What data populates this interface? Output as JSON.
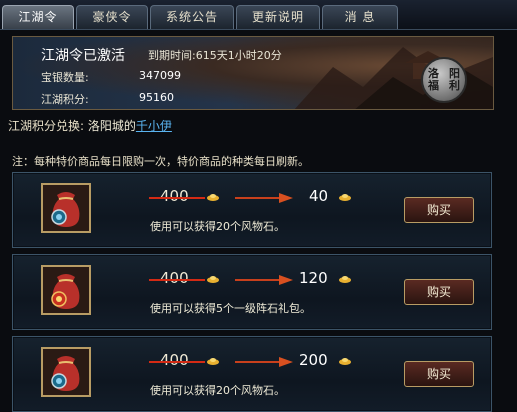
{
  "tabs": [
    {
      "label": "江湖令",
      "active": true
    },
    {
      "label": "豪侠令",
      "active": false
    },
    {
      "label": "系统公告",
      "active": false
    },
    {
      "label": "更新说明",
      "active": false
    },
    {
      "label": "消  息",
      "active": false
    }
  ],
  "banner": {
    "title": "江湖令已激活",
    "expire": "到期时间:615天1小时20分",
    "silver_label": "宝银数量:",
    "silver_value": "347099",
    "points_label": "江湖积分:",
    "points_value": "95160",
    "seal_chars": [
      "洛",
      "阳",
      "福",
      "利"
    ]
  },
  "exchange": {
    "label": "江湖积分兑换:",
    "place": "洛阳城的",
    "npc": "千小伊"
  },
  "note": "注：每种特价商品每日限购一次，特价商品的种类每日刷新。",
  "items": [
    {
      "old_price": "400",
      "new_price": "40",
      "desc": "使用可以获得20个风物石。",
      "buy_label": "购买",
      "icon": "red-pouch-blue-charm-icon"
    },
    {
      "old_price": "400",
      "new_price": "120",
      "desc": "使用可以获得5个一级阵石礼包。",
      "buy_label": "购买",
      "icon": "red-pouch-red-charm-icon"
    },
    {
      "old_price": "400",
      "new_price": "200",
      "desc": "使用可以获得20个风物石。",
      "buy_label": "购买",
      "icon": "red-pouch-blue-charm-icon"
    }
  ],
  "colors": {
    "npc_link": "#5ab4f0",
    "strike": "#d42a14",
    "button_border": "#b89c64"
  }
}
